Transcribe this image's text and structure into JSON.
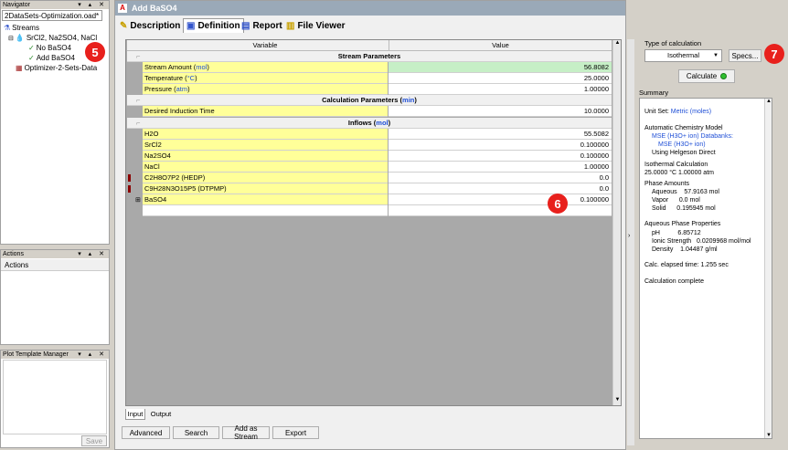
{
  "navigator": {
    "title": "Navigator",
    "file_tab": "2DataSets-Optimization.oad*",
    "tree": {
      "streams": "Streams",
      "mixture": "SrCl2, Na2SO4, NaCl",
      "no_baso4": "No BaSO4",
      "add_baso4": "Add BaSO4",
      "optimizer": "Optimizer-2-Sets-Data"
    }
  },
  "actions": {
    "title": "Actions",
    "header": "Actions"
  },
  "plot_template": {
    "title": "Plot Template Manager",
    "save_label": "Save"
  },
  "window": {
    "title": "Add BaSO4"
  },
  "tabs": [
    "Description",
    "Definition",
    "Report",
    "File Viewer"
  ],
  "grid": {
    "col_variable": "Variable",
    "col_value": "Value",
    "sections": {
      "stream": "Stream Parameters",
      "calc_prefix": "Calculation Parameters (",
      "calc_unit": "min",
      "inflows_prefix": "Inflows (",
      "inflows_unit": "mol",
      "suffix": ")"
    },
    "stream_rows": [
      {
        "name": "Stream Amount (",
        "unit": "mol",
        "suffix": ")",
        "value": "56.8082"
      },
      {
        "name": "Temperature (",
        "unit": "°C",
        "suffix": ")",
        "value": "25.0000"
      },
      {
        "name": "Pressure (",
        "unit": "atm",
        "suffix": ")",
        "value": "1.00000"
      }
    ],
    "calc_rows": [
      {
        "name": "Desired Induction Time",
        "value": "10.0000"
      }
    ],
    "inflow_rows": [
      {
        "name": "H2O",
        "value": "55.5082"
      },
      {
        "name": "SrCl2",
        "value": "0.100000"
      },
      {
        "name": "Na2SO4",
        "value": "0.100000"
      },
      {
        "name": "NaCl",
        "value": "1.00000"
      },
      {
        "name": "C2H8O7P2 (HEDP)",
        "value": "0.0"
      },
      {
        "name": "C9H28N3O15P5 (DTPMP)",
        "value": "0.0"
      },
      {
        "name": "BaSO4",
        "value": "0.100000"
      }
    ]
  },
  "bottom_tabs": [
    "Input",
    "Output"
  ],
  "bottom_buttons": [
    "Advanced",
    "Search",
    "Add as Stream",
    "Export"
  ],
  "right": {
    "type_label": "Type of calculation",
    "type_value": "Isothermal",
    "specs_label": "Specs...",
    "calculate_label": "Calculate",
    "summary_label": "Summary",
    "summary": {
      "unit_set_prefix": "Unit Set: ",
      "unit_set_value": "Metric (moles)",
      "acm_title": "Automatic Chemistry Model",
      "acm_db1": "MSE (H3O+ ion) Databanks:",
      "acm_db2": "MSE (H3O+ ion)",
      "acm_helgeson": "Using Helgeson Direct",
      "iso_title": "Isothermal Calculation",
      "iso_value": "25.0000 °C 1.00000 atm",
      "phase_title": "Phase Amounts",
      "aqueous": "Aqueous    57.9163 mol",
      "vapor": "Vapor      0.0 mol",
      "solid": "Solid      0.195945 mol",
      "aq_title": "Aqueous Phase Properties",
      "ph": "pH          6.85712",
      "ionic": "Ionic Strength   0.0209968 mol/mol",
      "density": "Density    1.04487 g/ml",
      "elapsed": "Calc. elapsed time: 1.255 sec",
      "complete": "Calculation complete"
    }
  },
  "badges": {
    "b5": "5",
    "b6": "6",
    "b7": "7"
  }
}
